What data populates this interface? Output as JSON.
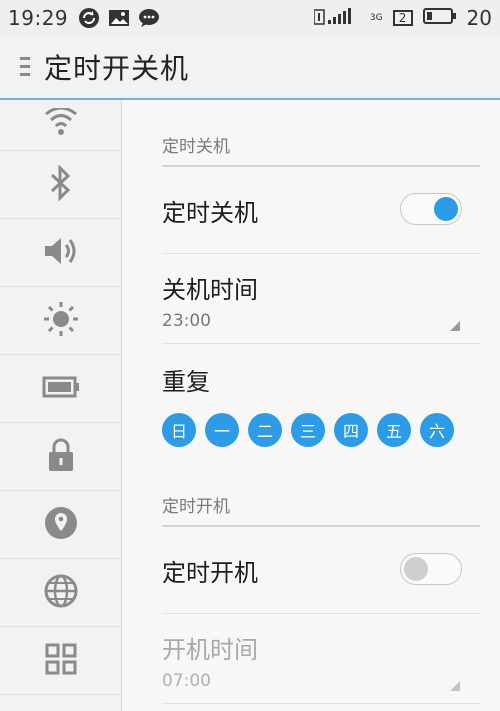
{
  "status_bar": {
    "time": "19:29",
    "battery": "20",
    "sim_badge": "2",
    "network": "3G",
    "icons": [
      "sync-icon",
      "image-icon",
      "chat-icon",
      "signal-icon",
      "sim-icon",
      "battery-icon"
    ]
  },
  "app_bar": {
    "title": "定时开关机",
    "menu_icon": "menu-icon"
  },
  "sidebar": {
    "items": [
      {
        "icon": "wifi-icon"
      },
      {
        "icon": "bluetooth-icon"
      },
      {
        "icon": "volume-icon"
      },
      {
        "icon": "brightness-icon"
      },
      {
        "icon": "battery-icon"
      },
      {
        "icon": "lock-icon"
      },
      {
        "icon": "location-icon"
      },
      {
        "icon": "globe-icon"
      },
      {
        "icon": "apps-grid-icon"
      }
    ]
  },
  "power_off": {
    "section_title": "定时关机",
    "toggle_label": "定时关机",
    "toggle_on": true,
    "time_label": "关机时间",
    "time_value": "23:00",
    "repeat_label": "重复",
    "days": [
      "日",
      "一",
      "二",
      "三",
      "四",
      "五",
      "六"
    ]
  },
  "power_on": {
    "section_title": "定时开机",
    "toggle_label": "定时开机",
    "toggle_on": false,
    "time_label": "开机时间",
    "time_value": "07:00"
  },
  "colors": {
    "accent": "#2b9ce6",
    "divider_accent": "#6fb3e3"
  }
}
